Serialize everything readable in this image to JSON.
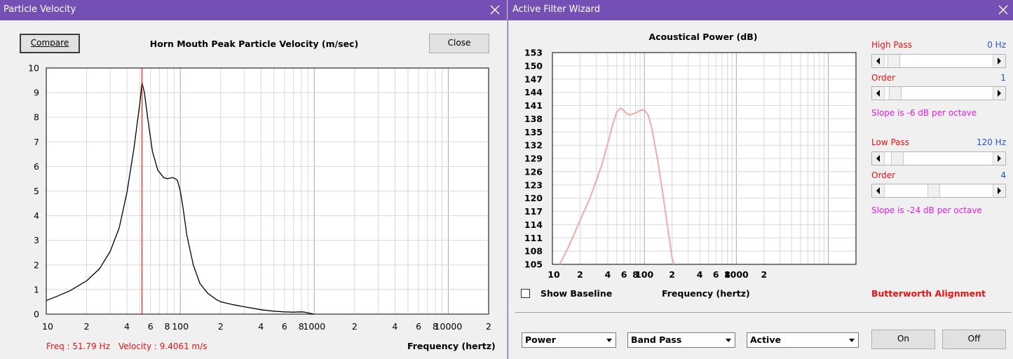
{
  "particle_window": {
    "title": "Particle Velocity",
    "compare_label": "Compare",
    "close_label": "Close",
    "readout": {
      "freq": "Freq : 51.79 Hz",
      "velocity": "Velocity : 9.4061 m/s"
    },
    "cursor_freq": 51.79
  },
  "filter_window": {
    "title": "Active Filter Wizard",
    "high_pass": {
      "label": "High Pass",
      "value": "0 Hz",
      "position": 0.02
    },
    "high_order": {
      "label": "Order",
      "value": "1",
      "position": 0.04
    },
    "high_slope": "Slope is -6 dB per octave",
    "low_pass": {
      "label": "Low Pass",
      "value": "120 Hz",
      "position": 0.06
    },
    "low_order": {
      "label": "Order",
      "value": "4",
      "position": 0.45
    },
    "low_slope": "Slope is -24 dB per octave",
    "show_baseline_label": "Show Baseline",
    "show_baseline_checked": false,
    "alignment": "Butterworth Alignment",
    "selects": [
      "Power",
      "Band Pass",
      "Active"
    ],
    "on_label": "On",
    "off_label": "Off"
  },
  "colors": {
    "titlebar": "#7450b4",
    "cursor": "#e02020",
    "power_curve": "#f4a8a8",
    "readout": "#e11111",
    "value_blue": "#2255dd",
    "slope_magenta": "#e020e0",
    "alignment_red": "#ee1111"
  },
  "chart_data": [
    {
      "type": "line",
      "title": "Horn Mouth Peak Particle Velocity (m/sec)",
      "xlabel": "Frequency (hertz)",
      "ylabel": "",
      "x_scale": "log",
      "xlim": [
        10,
        20000
      ],
      "ylim": [
        0,
        10
      ],
      "yticks": [
        "0",
        "1",
        "2",
        "3",
        "4",
        "5",
        "6",
        "7",
        "8",
        "9",
        "10"
      ],
      "xticks": [
        {
          "v": 10,
          "t": "10"
        },
        {
          "v": 20,
          "t": "2"
        },
        {
          "v": 40,
          "t": "4"
        },
        {
          "v": 60,
          "t": "6"
        },
        {
          "v": 80,
          "t": "8"
        },
        {
          "v": 100,
          "t": "100"
        },
        {
          "v": 200,
          "t": "2"
        },
        {
          "v": 400,
          "t": "4"
        },
        {
          "v": 600,
          "t": "6"
        },
        {
          "v": 800,
          "t": "8"
        },
        {
          "v": 1000,
          "t": "1000"
        },
        {
          "v": 2000,
          "t": "2"
        },
        {
          "v": 4000,
          "t": "4"
        },
        {
          "v": 6000,
          "t": "6"
        },
        {
          "v": 8000,
          "t": "8"
        },
        {
          "v": 10000,
          "t": "10000"
        },
        {
          "v": 20000,
          "t": "2"
        }
      ],
      "grid": true,
      "series": [
        {
          "x": [
            10,
            12,
            15,
            20,
            25,
            30,
            35,
            40,
            45,
            50,
            51.79,
            54,
            57,
            62,
            68,
            75,
            80,
            88,
            95,
            100,
            105,
            112,
            125,
            140,
            160,
            185,
            200,
            250,
            300,
            400,
            500,
            600,
            700,
            800,
            850,
            900,
            950,
            1000
          ],
          "y": [
            0.55,
            0.72,
            0.95,
            1.35,
            1.85,
            2.55,
            3.5,
            4.95,
            6.7,
            8.6,
            9.4061,
            9.0,
            8.0,
            6.6,
            5.85,
            5.55,
            5.5,
            5.55,
            5.45,
            5.0,
            4.3,
            3.2,
            2.0,
            1.25,
            0.85,
            0.6,
            0.5,
            0.38,
            0.3,
            0.18,
            0.12,
            0.09,
            0.08,
            0.09,
            0.08,
            0.05,
            0.02,
            0.0
          ]
        }
      ]
    },
    {
      "type": "line",
      "title": "Acoustical Power (dB)",
      "xlabel": "Frequency (hertz)",
      "ylabel": "",
      "x_scale": "log",
      "xlim": [
        10,
        20000
      ],
      "ylim": [
        105,
        153
      ],
      "yticks": [
        "105",
        "108",
        "111",
        "114",
        "117",
        "120",
        "123",
        "126",
        "129",
        "132",
        "135",
        "138",
        "141",
        "144",
        "147",
        "150",
        "153"
      ],
      "xticks": [
        {
          "v": 10,
          "t": "10"
        },
        {
          "v": 20,
          "t": "2"
        },
        {
          "v": 40,
          "t": "4"
        },
        {
          "v": 60,
          "t": "6"
        },
        {
          "v": 80,
          "t": "8"
        },
        {
          "v": 100,
          "t": "100"
        },
        {
          "v": 200,
          "t": "2"
        },
        {
          "v": 400,
          "t": "4"
        },
        {
          "v": 600,
          "t": "6"
        },
        {
          "v": 800,
          "t": "8"
        },
        {
          "v": 1000,
          "t": "1000"
        },
        {
          "v": 2000,
          "t": "2"
        }
      ],
      "grid": true,
      "series": [
        {
          "x": [
            12,
            15,
            20,
            25,
            30,
            35,
            40,
            45,
            50,
            55,
            60,
            65,
            70,
            80,
            90,
            100,
            110,
            120,
            140,
            160,
            180,
            200,
            210
          ],
          "y": [
            105.0,
            109.0,
            115.0,
            119.5,
            124.0,
            128.0,
            132.5,
            136.5,
            139.5,
            140.4,
            139.8,
            139.1,
            138.9,
            139.3,
            139.9,
            140.0,
            138.8,
            136.0,
            128.5,
            120.5,
            113.0,
            106.5,
            104.5
          ]
        }
      ]
    }
  ]
}
